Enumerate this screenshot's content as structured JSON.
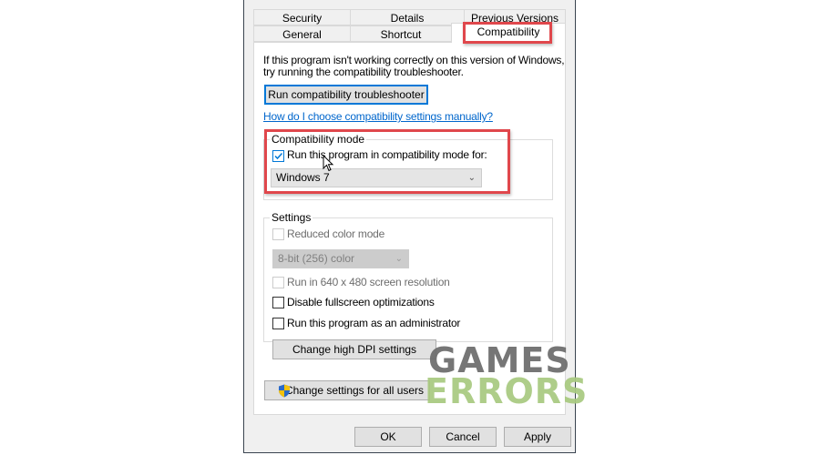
{
  "tabs": {
    "row1": [
      {
        "label": "Security"
      },
      {
        "label": "Details"
      },
      {
        "label": "Previous Versions"
      }
    ],
    "row2": [
      {
        "label": "General"
      },
      {
        "label": "Shortcut"
      },
      {
        "label": "Compatibility",
        "active": true
      }
    ]
  },
  "intro": {
    "line1": "If this program isn't working correctly on this version of Windows,",
    "line2": "try running the compatibility troubleshooter."
  },
  "troubleshooter_button": "Run compatibility troubleshooter",
  "help_link": "How do I choose compatibility settings manually?",
  "compatibility_mode": {
    "legend": "Compatibility mode",
    "checkbox_label": "Run this program in compatibility mode for:",
    "checked": true,
    "selected_os": "Windows 7"
  },
  "settings": {
    "legend": "Settings",
    "reduced_color": {
      "label": "Reduced color mode",
      "checked": false,
      "enabled": false
    },
    "color_select": "8-bit (256) color",
    "resolution": {
      "label": "Run in 640 x 480 screen resolution",
      "checked": false,
      "enabled": false
    },
    "fullscreen": {
      "label": "Disable fullscreen optimizations",
      "checked": false
    },
    "admin": {
      "label": "Run this program as an administrator",
      "checked": false
    },
    "dpi_button": "Change high DPI settings"
  },
  "all_users_button": "Change settings for all users",
  "footer": {
    "ok": "OK",
    "cancel": "Cancel",
    "apply": "Apply"
  },
  "watermark": {
    "line1": "GAMES",
    "line2": "ERRORS",
    "color1": "#6b6b6b",
    "color2": "#a8c97f"
  }
}
